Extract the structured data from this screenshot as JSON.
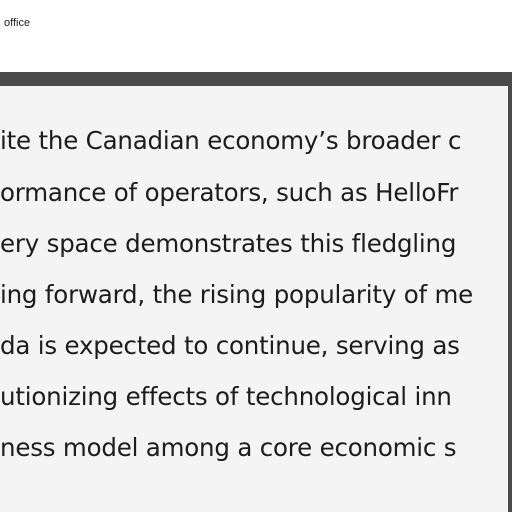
{
  "topbar": {
    "label": "office"
  },
  "document": {
    "lines": [
      "ite the Canadian economy’s broader c",
      "ormance of operators, such as HelloFr",
      "ery space demonstrates this fledgling",
      "ing forward, the rising popularity of me",
      "da is expected to continue, serving as",
      "utionizing effects of technological inn",
      "ness model among a core economic s"
    ]
  }
}
